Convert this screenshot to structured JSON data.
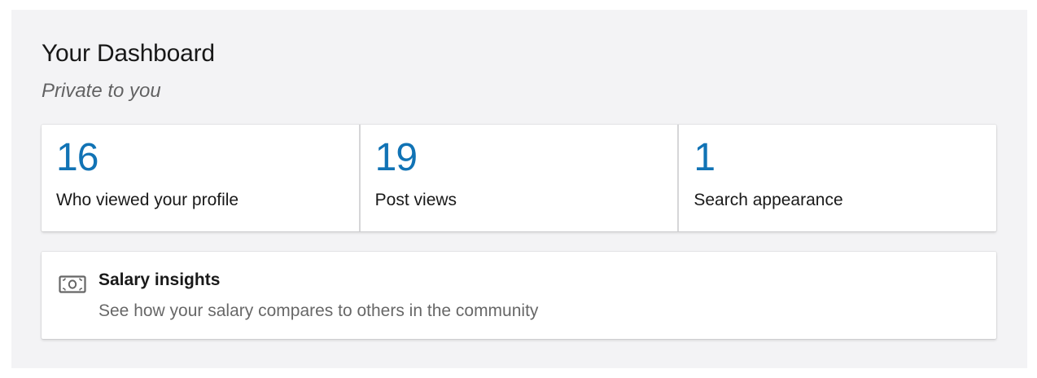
{
  "dashboard": {
    "title": "Your Dashboard",
    "subtitle": "Private to you"
  },
  "stats": [
    {
      "value": "16",
      "label": "Who viewed your profile"
    },
    {
      "value": "19",
      "label": "Post views"
    },
    {
      "value": "1",
      "label": "Search appearance"
    }
  ],
  "salary": {
    "icon": "money-bill-icon",
    "title": "Salary insights",
    "description": "See how your salary compares to others in the community"
  },
  "colors": {
    "accent": "#1173b5",
    "panel_background": "#f3f3f5",
    "card_background": "#ffffff"
  }
}
